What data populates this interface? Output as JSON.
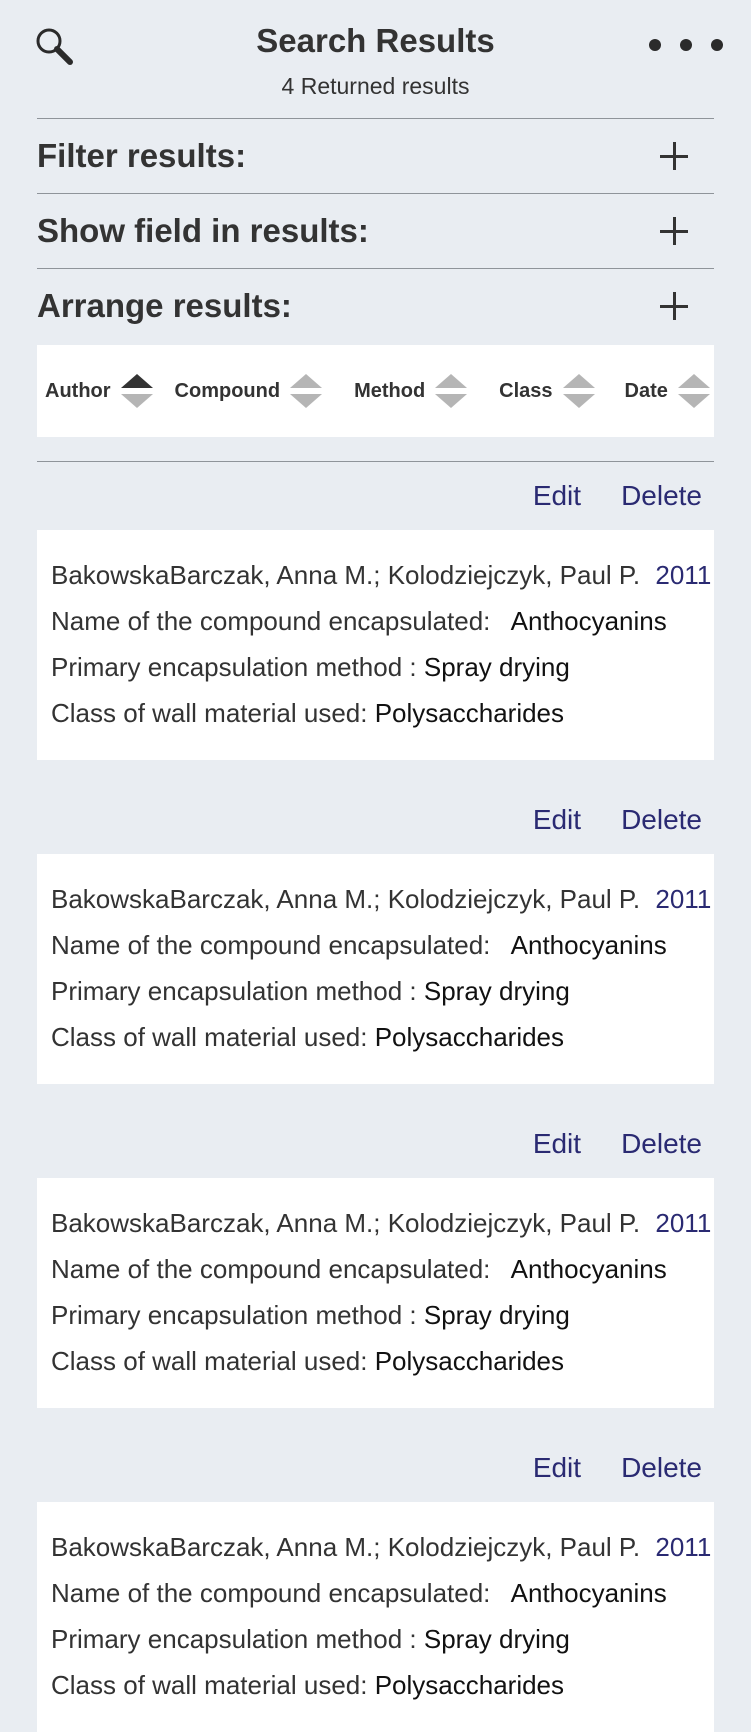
{
  "header": {
    "title": "Search Results",
    "subtitle": "4 Returned results"
  },
  "sections": {
    "filter": "Filter results:",
    "show_field": "Show field in results:",
    "arrange": "Arrange results:"
  },
  "sort": {
    "columns": [
      "Author",
      "Compound",
      "Method",
      "Class",
      "Date"
    ],
    "active": "Author"
  },
  "actions": {
    "edit": "Edit",
    "delete": "Delete"
  },
  "labels": {
    "compound": "Name of the compound encapsulated:",
    "method": "Primary encapsulation method :",
    "class": "Class of wall material used:"
  },
  "results": [
    {
      "authors": "BakowskaBarczak, Anna M.; Kolodziejczyk, Paul P.",
      "year": "2011",
      "compound": "Anthocyanins",
      "method": "Spray drying",
      "class": "Polysaccharides"
    },
    {
      "authors": "BakowskaBarczak, Anna M.; Kolodziejczyk, Paul P.",
      "year": "2011",
      "compound": "Anthocyanins",
      "method": "Spray drying",
      "class": "Polysaccharides"
    },
    {
      "authors": "BakowskaBarczak, Anna M.; Kolodziejczyk, Paul P.",
      "year": "2011",
      "compound": "Anthocyanins",
      "method": "Spray drying",
      "class": "Polysaccharides"
    },
    {
      "authors": "BakowskaBarczak, Anna M.; Kolodziejczyk, Paul P.",
      "year": "2011",
      "compound": "Anthocyanins",
      "method": "Spray drying",
      "class": "Polysaccharides"
    }
  ],
  "icons": {
    "search": "search-icon",
    "more": "more-options-icon",
    "expand": "plus-icon",
    "sort": "sort-arrows-icon"
  },
  "colors": {
    "background": "#e9edf2",
    "card": "#ffffff",
    "link": "#2a2a72",
    "text": "#333333",
    "sort_inactive": "#b5b5b5"
  }
}
